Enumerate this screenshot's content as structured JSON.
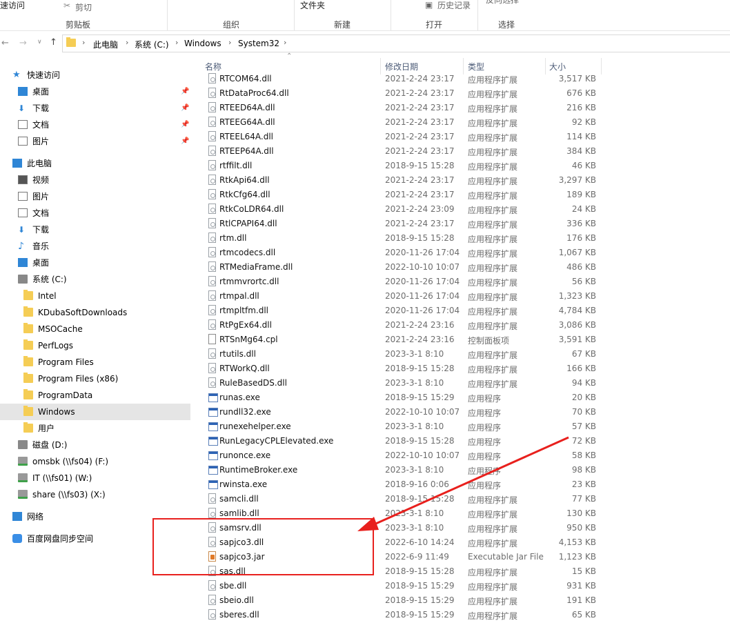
{
  "ribbon": {
    "quick_access_cut": "速访问",
    "cut": "剪切",
    "folder": "文件夹",
    "history": "历史记录",
    "partial_right": "反向选择",
    "groups": [
      "剪贴板",
      "组织",
      "新建",
      "打开",
      "选择"
    ]
  },
  "breadcrumb": [
    "此电脑",
    "系统 (C:)",
    "Windows",
    "System32"
  ],
  "sidebar": {
    "items": [
      {
        "label": "快速访问",
        "icon": "star-icon",
        "level": 0,
        "pinned": false
      },
      {
        "label": "桌面",
        "icon": "desktop-icon",
        "level": 1,
        "pinned": true
      },
      {
        "label": "下载",
        "icon": "download-icon",
        "level": 1,
        "pinned": true
      },
      {
        "label": "文档",
        "icon": "document-icon",
        "level": 1,
        "pinned": true
      },
      {
        "label": "图片",
        "icon": "picture-icon",
        "level": 1,
        "pinned": true
      },
      {
        "label": "此电脑",
        "icon": "computer-icon",
        "level": 0,
        "pinned": false
      },
      {
        "label": "视频",
        "icon": "video-icon",
        "level": 1,
        "pinned": false
      },
      {
        "label": "图片",
        "icon": "picture-icon",
        "level": 1,
        "pinned": false
      },
      {
        "label": "文档",
        "icon": "document-icon",
        "level": 1,
        "pinned": false
      },
      {
        "label": "下载",
        "icon": "download-icon",
        "level": 1,
        "pinned": false
      },
      {
        "label": "音乐",
        "icon": "music-icon",
        "level": 1,
        "pinned": false
      },
      {
        "label": "桌面",
        "icon": "desktop-icon",
        "level": 1,
        "pinned": false
      },
      {
        "label": "系统 (C:)",
        "icon": "system-drive-icon",
        "level": 1,
        "pinned": false
      },
      {
        "label": "Intel",
        "icon": "folder-icon",
        "level": 2,
        "pinned": false
      },
      {
        "label": "KDubaSoftDownloads",
        "icon": "folder-icon",
        "level": 2,
        "pinned": false
      },
      {
        "label": "MSOCache",
        "icon": "folder-icon",
        "level": 2,
        "pinned": false
      },
      {
        "label": "PerfLogs",
        "icon": "folder-icon",
        "level": 2,
        "pinned": false
      },
      {
        "label": "Program Files",
        "icon": "folder-icon",
        "level": 2,
        "pinned": false
      },
      {
        "label": "Program Files (x86)",
        "icon": "folder-icon",
        "level": 2,
        "pinned": false
      },
      {
        "label": "ProgramData",
        "icon": "folder-icon",
        "level": 2,
        "pinned": false
      },
      {
        "label": "Windows",
        "icon": "folder-icon",
        "level": 2,
        "pinned": false,
        "selected": true
      },
      {
        "label": "用户",
        "icon": "folder-icon",
        "level": 2,
        "pinned": false
      },
      {
        "label": "磁盘 (D:)",
        "icon": "drive-icon",
        "level": 1,
        "pinned": false
      },
      {
        "label": "omsbk (\\\\fs04) (F:)",
        "icon": "network-drive-icon",
        "level": 1,
        "pinned": false
      },
      {
        "label": "IT (\\\\fs01) (W:)",
        "icon": "network-drive-icon",
        "level": 1,
        "pinned": false
      },
      {
        "label": "share (\\\\fs03) (X:)",
        "icon": "network-drive-icon",
        "level": 1,
        "pinned": false
      },
      {
        "label": "网络",
        "icon": "network-icon",
        "level": 0,
        "pinned": false
      },
      {
        "label": "百度网盘同步空间",
        "icon": "baidu-netdisk-icon",
        "level": 0,
        "pinned": false
      }
    ]
  },
  "columns": {
    "name": "名称",
    "date": "修改日期",
    "type": "类型",
    "size": "大小"
  },
  "files": [
    {
      "name": "RTCOM64.dll",
      "date": "2021-2-24 23:17",
      "type": "应用程序扩展",
      "size": "3,517 KB",
      "icon": "dll"
    },
    {
      "name": "RtDataProc64.dll",
      "date": "2021-2-24 23:17",
      "type": "应用程序扩展",
      "size": "676 KB",
      "icon": "dll"
    },
    {
      "name": "RTEED64A.dll",
      "date": "2021-2-24 23:17",
      "type": "应用程序扩展",
      "size": "216 KB",
      "icon": "dll"
    },
    {
      "name": "RTEEG64A.dll",
      "date": "2021-2-24 23:17",
      "type": "应用程序扩展",
      "size": "92 KB",
      "icon": "dll"
    },
    {
      "name": "RTEEL64A.dll",
      "date": "2021-2-24 23:17",
      "type": "应用程序扩展",
      "size": "114 KB",
      "icon": "dll"
    },
    {
      "name": "RTEEP64A.dll",
      "date": "2021-2-24 23:17",
      "type": "应用程序扩展",
      "size": "384 KB",
      "icon": "dll"
    },
    {
      "name": "rtffilt.dll",
      "date": "2018-9-15 15:28",
      "type": "应用程序扩展",
      "size": "46 KB",
      "icon": "dll"
    },
    {
      "name": "RtkApi64.dll",
      "date": "2021-2-24 23:17",
      "type": "应用程序扩展",
      "size": "3,297 KB",
      "icon": "dll"
    },
    {
      "name": "RtkCfg64.dll",
      "date": "2021-2-24 23:17",
      "type": "应用程序扩展",
      "size": "189 KB",
      "icon": "dll"
    },
    {
      "name": "RtkCoLDR64.dll",
      "date": "2021-2-24 23:09",
      "type": "应用程序扩展",
      "size": "24 KB",
      "icon": "dll"
    },
    {
      "name": "RtlCPAPI64.dll",
      "date": "2021-2-24 23:17",
      "type": "应用程序扩展",
      "size": "336 KB",
      "icon": "dll"
    },
    {
      "name": "rtm.dll",
      "date": "2018-9-15 15:28",
      "type": "应用程序扩展",
      "size": "176 KB",
      "icon": "dll"
    },
    {
      "name": "rtmcodecs.dll",
      "date": "2020-11-26 17:04",
      "type": "应用程序扩展",
      "size": "1,067 KB",
      "icon": "dll"
    },
    {
      "name": "RTMediaFrame.dll",
      "date": "2022-10-10 10:07",
      "type": "应用程序扩展",
      "size": "486 KB",
      "icon": "dll"
    },
    {
      "name": "rtmmvrortc.dll",
      "date": "2020-11-26 17:04",
      "type": "应用程序扩展",
      "size": "56 KB",
      "icon": "dll"
    },
    {
      "name": "rtmpal.dll",
      "date": "2020-11-26 17:04",
      "type": "应用程序扩展",
      "size": "1,323 KB",
      "icon": "dll"
    },
    {
      "name": "rtmpltfm.dll",
      "date": "2020-11-26 17:04",
      "type": "应用程序扩展",
      "size": "4,784 KB",
      "icon": "dll"
    },
    {
      "name": "RtPgEx64.dll",
      "date": "2021-2-24 23:16",
      "type": "应用程序扩展",
      "size": "3,086 KB",
      "icon": "dll"
    },
    {
      "name": "RTSnMg64.cpl",
      "date": "2021-2-24 23:16",
      "type": "控制面板项",
      "size": "3,591 KB",
      "icon": "cpl"
    },
    {
      "name": "rtutils.dll",
      "date": "2023-3-1 8:10",
      "type": "应用程序扩展",
      "size": "67 KB",
      "icon": "dll"
    },
    {
      "name": "RTWorkQ.dll",
      "date": "2018-9-15 15:28",
      "type": "应用程序扩展",
      "size": "166 KB",
      "icon": "dll"
    },
    {
      "name": "RuleBasedDS.dll",
      "date": "2023-3-1 8:10",
      "type": "应用程序扩展",
      "size": "94 KB",
      "icon": "dll"
    },
    {
      "name": "runas.exe",
      "date": "2018-9-15 15:29",
      "type": "应用程序",
      "size": "20 KB",
      "icon": "exe"
    },
    {
      "name": "rundll32.exe",
      "date": "2022-10-10 10:07",
      "type": "应用程序",
      "size": "70 KB",
      "icon": "exe"
    },
    {
      "name": "runexehelper.exe",
      "date": "2023-3-1 8:10",
      "type": "应用程序",
      "size": "57 KB",
      "icon": "exe"
    },
    {
      "name": "RunLegacyCPLElevated.exe",
      "date": "2018-9-15 15:28",
      "type": "应用程序",
      "size": "72 KB",
      "icon": "exe"
    },
    {
      "name": "runonce.exe",
      "date": "2022-10-10 10:07",
      "type": "应用程序",
      "size": "58 KB",
      "icon": "exe"
    },
    {
      "name": "RuntimeBroker.exe",
      "date": "2023-3-1 8:10",
      "type": "应用程序",
      "size": "98 KB",
      "icon": "exe"
    },
    {
      "name": "rwinsta.exe",
      "date": "2018-9-16 0:06",
      "type": "应用程序",
      "size": "23 KB",
      "icon": "exe"
    },
    {
      "name": "samcli.dll",
      "date": "2018-9-15 15:28",
      "type": "应用程序扩展",
      "size": "77 KB",
      "icon": "dll"
    },
    {
      "name": "samlib.dll",
      "date": "2023-3-1 8:10",
      "type": "应用程序扩展",
      "size": "130 KB",
      "icon": "dll"
    },
    {
      "name": "samsrv.dll",
      "date": "2023-3-1 8:10",
      "type": "应用程序扩展",
      "size": "950 KB",
      "icon": "dll"
    },
    {
      "name": "sapjco3.dll",
      "date": "2022-6-10 14:24",
      "type": "应用程序扩展",
      "size": "4,153 KB",
      "icon": "dll"
    },
    {
      "name": "sapjco3.jar",
      "date": "2022-6-9 11:49",
      "type": "Executable Jar File",
      "size": "1,123 KB",
      "icon": "jar"
    },
    {
      "name": "sas.dll",
      "date": "2018-9-15 15:28",
      "type": "应用程序扩展",
      "size": "15 KB",
      "icon": "dll"
    },
    {
      "name": "sbe.dll",
      "date": "2018-9-15 15:29",
      "type": "应用程序扩展",
      "size": "931 KB",
      "icon": "dll"
    },
    {
      "name": "sbeio.dll",
      "date": "2018-9-15 15:29",
      "type": "应用程序扩展",
      "size": "191 KB",
      "icon": "dll"
    },
    {
      "name": "sberes.dll",
      "date": "2018-9-15 15:29",
      "type": "应用程序扩展",
      "size": "65 KB",
      "icon": "dll"
    }
  ],
  "annotation": {
    "color": "#e8201d"
  }
}
